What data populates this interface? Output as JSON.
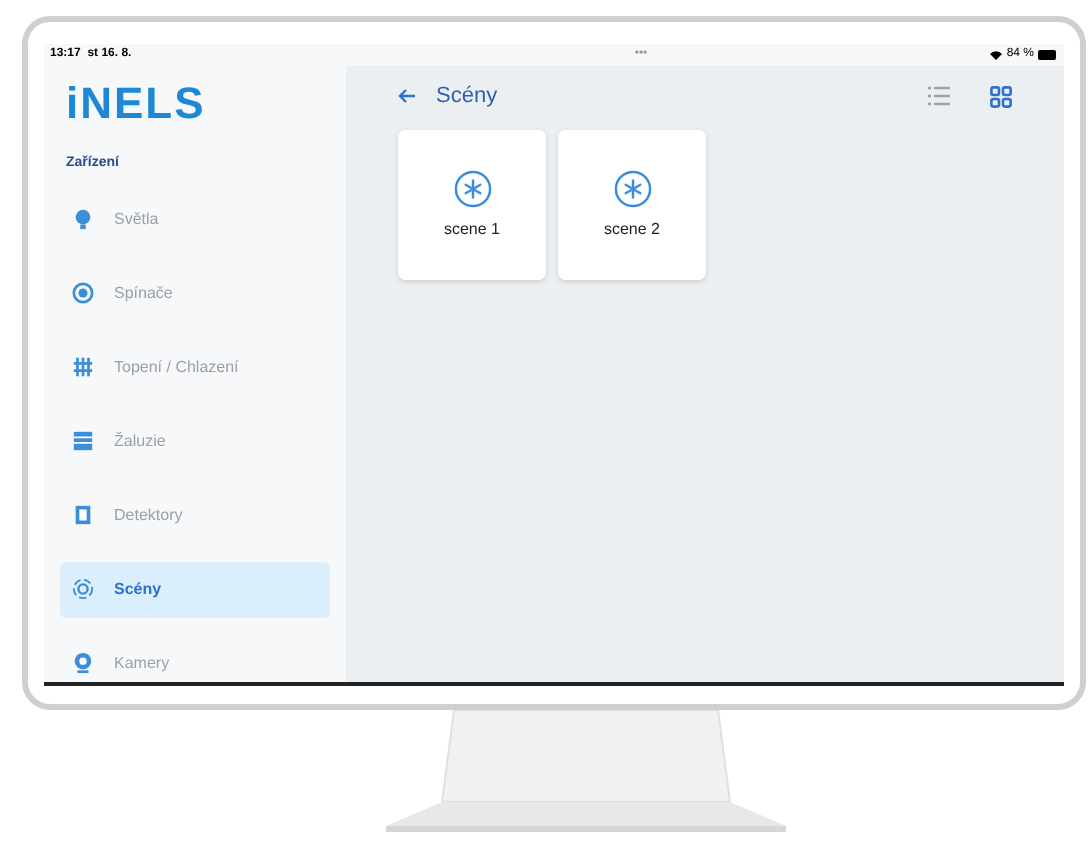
{
  "status_bar": {
    "time": "13:17",
    "date": "st 16. 8.",
    "battery": "84 %",
    "dots": "•••"
  },
  "sidebar": {
    "logo": "iNELS",
    "section": "Zařízení",
    "items": [
      {
        "label": "Světla",
        "selected": false
      },
      {
        "label": "Spínače",
        "selected": false
      },
      {
        "label": "Topení / Chlazení",
        "selected": false
      },
      {
        "label": "Žaluzie",
        "selected": false
      },
      {
        "label": "Detektory",
        "selected": false
      },
      {
        "label": "Scény",
        "selected": true
      },
      {
        "label": "Kamery",
        "selected": false
      }
    ]
  },
  "main": {
    "title": "Scény",
    "view_toggle": [
      {
        "kind": "list",
        "selected": false
      },
      {
        "kind": "grid",
        "selected": true
      }
    ],
    "cards": [
      {
        "label": "scene 1"
      },
      {
        "label": "scene 2"
      }
    ]
  }
}
